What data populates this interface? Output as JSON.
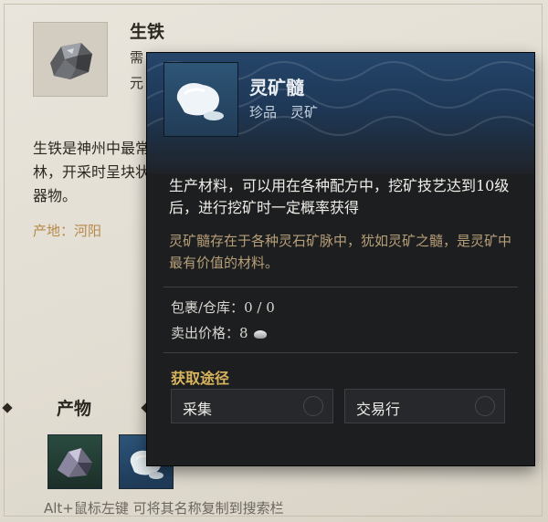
{
  "item": {
    "name": "生铁",
    "meta_line1": "需",
    "meta_line2": "元",
    "description": "生铁是神州中最常见的金属矿石之一，广泛产于川南、西南等山与相思木林，开采时呈块状或粒状，其产物可用于锻造武器、防具，或用于铸造各种器物。",
    "origin": "产地：河阳"
  },
  "tooltip": {
    "name": "灵矿髓",
    "subtitle": "珍品　灵矿",
    "desc_main": "生产材料，可以用在各种配方中，挖矿技艺达到10级后，进行挖矿时一定概率获得",
    "desc_flavor": "灵矿髓存在于各种灵石矿脉中，犹如灵矿之髓，是灵矿中最有价值的材料。",
    "inventory_label": "包裹/仓库：",
    "inventory_value": "0 / 0",
    "price_label": "卖出价格：",
    "price_value": "8",
    "acquire_title": "获取途径",
    "sources": [
      "采集",
      "交易行"
    ]
  },
  "products": {
    "title": "产物"
  },
  "hint": "Alt+鼠标左键 可将其名称复制到搜索栏",
  "colors": {
    "panel_bg": "#e6e2d8",
    "tooltip_bg": "#1d1e20",
    "accent_gold": "#d9b65d",
    "flavor_text": "#b79f77",
    "origin_text": "#b6894a"
  },
  "icons": {
    "item": "iron-ore-icon",
    "tooltip": "spirit-ore-marrow-icon",
    "currency": "silver-ingot-icon"
  }
}
